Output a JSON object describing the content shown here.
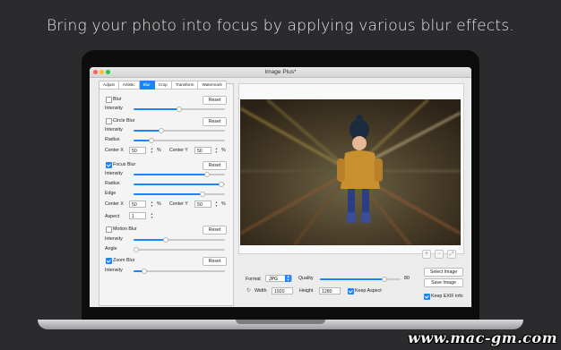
{
  "headline": "Bring your photo into focus by applying various blur effects.",
  "window": {
    "title": "Image Plus*"
  },
  "tabs": [
    {
      "label": "Adjust",
      "active": false
    },
    {
      "label": "Artistic",
      "active": false
    },
    {
      "label": "Blur",
      "active": true
    },
    {
      "label": "Crop",
      "active": false
    },
    {
      "label": "Transform",
      "active": false
    },
    {
      "label": "Watermark",
      "active": false
    }
  ],
  "blur": {
    "label": "Blur",
    "checked": false,
    "reset": "Reset",
    "intensity_label": "Intensity",
    "intensity": 0.5
  },
  "circle_blur": {
    "label": "Circle Blur",
    "checked": false,
    "reset": "Reset",
    "intensity_label": "Intensity",
    "intensity": 0.3,
    "radius_label": "Radius",
    "radius": 0.2,
    "center_x_label": "Center X",
    "center_x": "50",
    "center_y_label": "Center Y",
    "center_y": "50",
    "unit": "%"
  },
  "focus_blur": {
    "label": "Focus Blur",
    "checked": true,
    "reset": "Reset",
    "intensity_label": "Intensity",
    "intensity": 0.8,
    "radius_label": "Radius",
    "radius": 0.96,
    "edge_label": "Edge",
    "edge": 0.75,
    "center_x_label": "Center X",
    "center_x": "50",
    "center_y_label": "Center Y",
    "center_y": "50",
    "unit": "%",
    "aspect_label": "Aspect",
    "aspect": "1"
  },
  "motion_blur": {
    "label": "Motion Blur",
    "checked": false,
    "reset": "Reset",
    "intensity_label": "Intensity",
    "intensity": 0.35,
    "angle_label": "Angle",
    "angle": 0.0
  },
  "zoom_blur": {
    "label": "Zoom Blur",
    "checked": true,
    "reset": "Reset",
    "intensity_label": "Intensity",
    "intensity": 0.12
  },
  "zoom_controls": {
    "plus": "+",
    "minus": "−",
    "fit": "⤢"
  },
  "export": {
    "format_label": "Format",
    "format": "JPG",
    "quality_label": "Quality",
    "quality_value": "80",
    "quality": 0.8,
    "width_label": "Width",
    "width": "1920",
    "height_label": "Height",
    "height": "1280",
    "keep_aspect_label": "Keep Aspect",
    "keep_aspect": true,
    "keep_exif_label": "Keep EXIF info",
    "keep_exif": true,
    "select_image": "Select Image",
    "save_image": "Save Image"
  },
  "watermark_text": "www.mac-gm.com",
  "colors": {
    "accent": "#1b84ff",
    "background": "#2b2b2d"
  }
}
